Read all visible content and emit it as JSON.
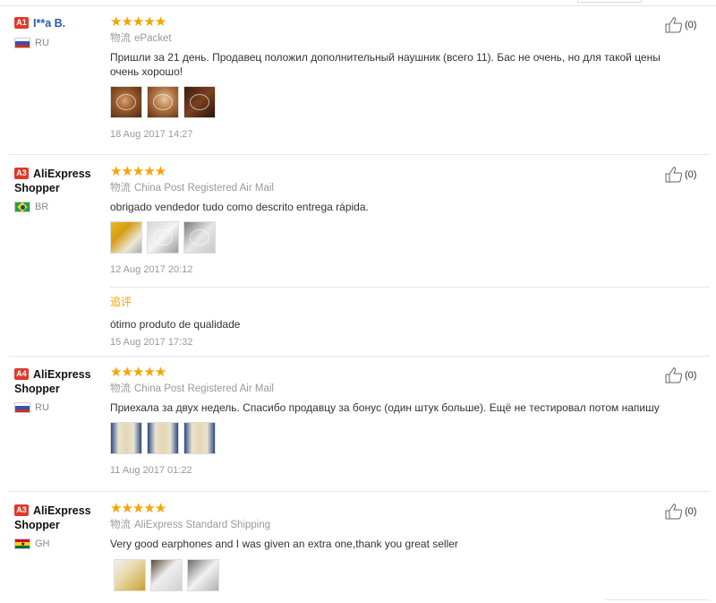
{
  "reviews": [
    {
      "level": "A1",
      "name_first": "I**a B.",
      "name_rest": "",
      "country": "RU",
      "flag": "ru",
      "stars": "★★★★★",
      "shipping_label": "物流",
      "shipping_method": "ePacket",
      "comment": "Пришли за 21 день. Продавец положил дополнительный наушник (всего 11). Бас не очень, но для такой цены очень хорошо!",
      "images": [
        "img-brown1",
        "img-brown2",
        "img-brown3"
      ],
      "date": "18 Aug 2017 14:27",
      "helpful_count": "(0)"
    },
    {
      "level": "A3",
      "name_first": "AliExpress",
      "name_rest": "Shopper",
      "country": "BR",
      "flag": "br",
      "stars": "★★★★★",
      "shipping_label": "物流",
      "shipping_method": "China Post Registered Air Mail",
      "comment": "obrigado vendedor tudo como descrito entrega rápida.",
      "images": [
        "img-yellow",
        "img-gray1",
        "img-gray2"
      ],
      "date": "12 Aug 2017 20:12",
      "followup_label": "追评",
      "followup_comment": "ótimo produto de qualidade",
      "followup_date": "15 Aug 2017 17:32",
      "helpful_count": "(0)"
    },
    {
      "level": "A4",
      "name_first": "AliExpress",
      "name_rest": "Shopper",
      "country": "RU",
      "flag": "ru",
      "stars": "★★★★★",
      "shipping_label": "物流",
      "shipping_method": "China Post Registered Air Mail",
      "comment": "Приехала за двух недель. Спасибо продавцу за бонус (один штук больше). Ещё не тестировал потом напишу",
      "images": [
        "img-blue",
        "img-blue",
        "img-blue"
      ],
      "date": "11 Aug 2017 01:22",
      "helpful_count": "(0)"
    },
    {
      "level": "A3",
      "name_first": "AliExpress",
      "name_rest": "Shopper",
      "country": "GH",
      "flag": "gh",
      "stars": "★★★★★",
      "shipping_label": "物流",
      "shipping_method": "AliExpress Standard Shipping",
      "comment": "Very good earphones and I was given an extra one,thank you great seller",
      "images": [
        "img-pack1",
        "img-pack2",
        "img-pack3"
      ],
      "date": "",
      "helpful_count": "(0)"
    }
  ],
  "colors": {
    "star": "#f7a300",
    "level_badge": "#e0392b",
    "followup_label": "#f7a300",
    "muted_text": "#999999"
  },
  "icons": {
    "helpful": "thumbs-up-icon",
    "level": "level-badge"
  }
}
